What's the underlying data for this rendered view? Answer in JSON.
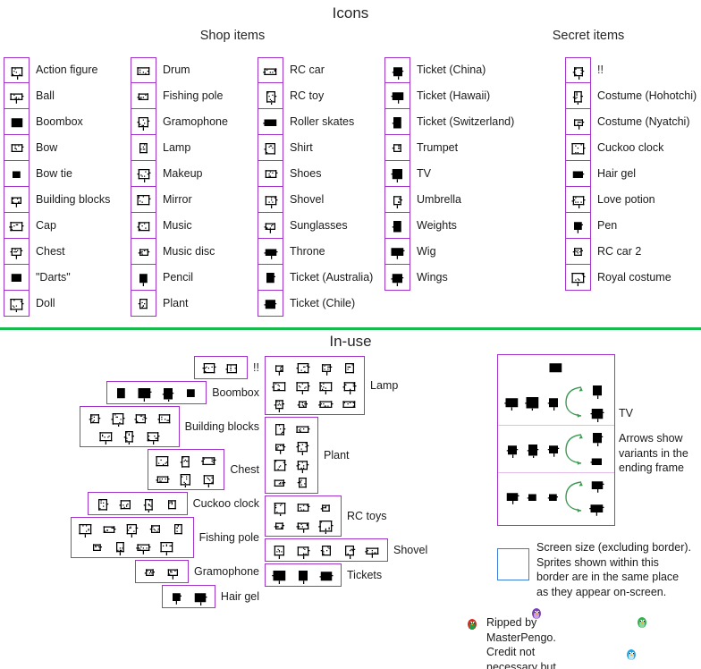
{
  "page": {
    "title": "Icons",
    "divider_color": "#18ba4b",
    "cell_border_color": "#a234c9",
    "screen_box_color": "#3b7dd8"
  },
  "sections": {
    "shop_items": {
      "heading": "Shop items"
    },
    "secret_items": {
      "heading": "Secret items"
    },
    "in_use": {
      "heading": "In-use"
    }
  },
  "icon_columns": [
    {
      "name": "shop-column-1",
      "items": [
        {
          "label": "Action figure",
          "icon": "action-figure-icon"
        },
        {
          "label": "Ball",
          "icon": "ball-icon"
        },
        {
          "label": "Boombox",
          "icon": "boombox-icon"
        },
        {
          "label": "Bow",
          "icon": "bow-icon"
        },
        {
          "label": "Bow tie",
          "icon": "bow-tie-icon"
        },
        {
          "label": "Building blocks",
          "icon": "building-blocks-icon"
        },
        {
          "label": "Cap",
          "icon": "cap-icon"
        },
        {
          "label": "Chest",
          "icon": "chest-icon"
        },
        {
          "label": "\"Darts\"",
          "icon": "darts-icon"
        },
        {
          "label": "Doll",
          "icon": "doll-icon"
        }
      ]
    },
    {
      "name": "shop-column-2",
      "items": [
        {
          "label": "Drum",
          "icon": "drum-icon"
        },
        {
          "label": "Fishing pole",
          "icon": "fishing-pole-icon"
        },
        {
          "label": "Gramophone",
          "icon": "gramophone-icon"
        },
        {
          "label": "Lamp",
          "icon": "lamp-icon"
        },
        {
          "label": "Makeup",
          "icon": "makeup-icon"
        },
        {
          "label": "Mirror",
          "icon": "mirror-icon"
        },
        {
          "label": "Music",
          "icon": "music-icon"
        },
        {
          "label": "Music disc",
          "icon": "music-disc-icon"
        },
        {
          "label": "Pencil",
          "icon": "pencil-icon"
        },
        {
          "label": "Plant",
          "icon": "plant-icon"
        }
      ]
    },
    {
      "name": "shop-column-3",
      "items": [
        {
          "label": "RC car",
          "icon": "rc-car-icon"
        },
        {
          "label": "RC toy",
          "icon": "rc-toy-icon"
        },
        {
          "label": "Roller skates",
          "icon": "roller-skates-icon"
        },
        {
          "label": "Shirt",
          "icon": "shirt-icon"
        },
        {
          "label": "Shoes",
          "icon": "shoes-icon"
        },
        {
          "label": "Shovel",
          "icon": "shovel-icon"
        },
        {
          "label": "Sunglasses",
          "icon": "sunglasses-icon"
        },
        {
          "label": "Throne",
          "icon": "throne-icon"
        },
        {
          "label": "Ticket (Australia)",
          "icon": "ticket-australia-icon"
        },
        {
          "label": "Ticket (Chile)",
          "icon": "ticket-chile-icon"
        }
      ]
    },
    {
      "name": "shop-column-4",
      "items": [
        {
          "label": "Ticket (China)",
          "icon": "ticket-china-icon"
        },
        {
          "label": "Ticket (Hawaii)",
          "icon": "ticket-hawaii-icon"
        },
        {
          "label": "Ticket (Switzerland)",
          "icon": "ticket-switzerland-icon"
        },
        {
          "label": "Trumpet",
          "icon": "trumpet-icon"
        },
        {
          "label": "TV",
          "icon": "tv-icon"
        },
        {
          "label": "Umbrella",
          "icon": "umbrella-icon"
        },
        {
          "label": "Weights",
          "icon": "weights-icon"
        },
        {
          "label": "Wig",
          "icon": "wig-icon"
        },
        {
          "label": "Wings",
          "icon": "wings-icon"
        }
      ]
    },
    {
      "name": "secret-column-1",
      "items": [
        {
          "label": "!!",
          "icon": "exclamation-icon"
        },
        {
          "label": "Costume (Hohotchi)",
          "icon": "costume-hohotchi-icon"
        },
        {
          "label": "Costume (Nyatchi)",
          "icon": "costume-nyatchi-icon"
        },
        {
          "label": "Cuckoo clock",
          "icon": "cuckoo-clock-icon"
        },
        {
          "label": "Hair gel",
          "icon": "hair-gel-icon"
        },
        {
          "label": "Love potion",
          "icon": "love-potion-icon"
        },
        {
          "label": "Pen",
          "icon": "pen-icon"
        },
        {
          "label": "RC car 2",
          "icon": "rc-car-2-icon"
        },
        {
          "label": "Royal costume",
          "icon": "royal-costume-icon"
        }
      ]
    }
  ],
  "in_use_left": [
    {
      "label": "!!",
      "frames": 2,
      "rows": 1
    },
    {
      "label": "Boombox",
      "frames": 4,
      "rows": 1
    },
    {
      "label": "Building blocks",
      "frames": 7,
      "rows": 2
    },
    {
      "label": "Chest",
      "frames": 6,
      "rows": 2
    },
    {
      "label": "Cuckoo clock",
      "frames": 4,
      "rows": 1
    },
    {
      "label": "Fishing pole",
      "frames": 9,
      "rows": 2
    },
    {
      "label": "Gramophone",
      "frames": 2,
      "rows": 1
    },
    {
      "label": "Hair gel",
      "frames": 2,
      "rows": 1
    }
  ],
  "in_use_middle": [
    {
      "label": "Lamp",
      "frames": 12,
      "rows": 3
    },
    {
      "label": "Plant",
      "frames": 8,
      "rows": 4
    },
    {
      "label": "RC toys",
      "frames": 6,
      "rows": 2
    },
    {
      "label": "Shovel",
      "frames": 5,
      "rows": 1
    },
    {
      "label": "Tickets",
      "frames": 3,
      "rows": 1
    }
  ],
  "in_use_right": {
    "label": "TV",
    "note": "Arrows show\nvariants in the\nending frame",
    "sections": 3
  },
  "legend": {
    "screen_note": "Screen size (excluding border).\nSprites shown within this\nborder are in the same place\nas they appear on-screen.",
    "credit": "Ripped by MasterPengo.\nCredit not necessary but would\nbe highly appreciated!"
  }
}
